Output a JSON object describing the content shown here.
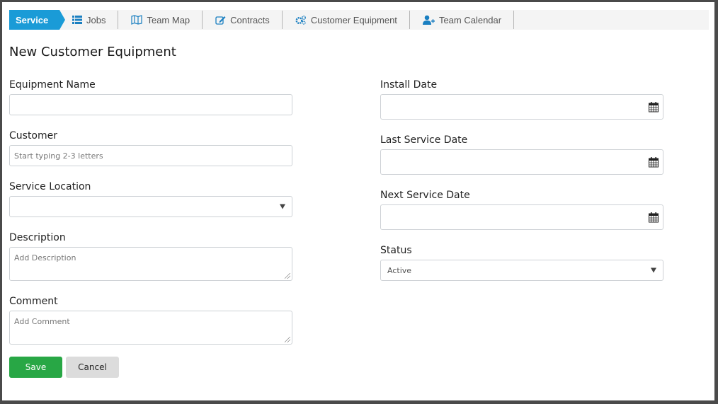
{
  "nav": {
    "section": "Service",
    "items": [
      {
        "label": "Jobs",
        "icon": "list-icon"
      },
      {
        "label": "Team Map",
        "icon": "map-icon"
      },
      {
        "label": "Contracts",
        "icon": "edit-icon"
      },
      {
        "label": "Customer Equipment",
        "icon": "gears-icon"
      },
      {
        "label": "Team Calendar",
        "icon": "user-plus-icon"
      }
    ]
  },
  "page": {
    "title": "New Customer Equipment"
  },
  "form": {
    "equipment_name": {
      "label": "Equipment Name",
      "value": ""
    },
    "customer": {
      "label": "Customer",
      "placeholder": "Start typing 2-3 letters"
    },
    "service_location": {
      "label": "Service Location",
      "value": ""
    },
    "description": {
      "label": "Description",
      "placeholder": "Add Description"
    },
    "comment": {
      "label": "Comment",
      "placeholder": "Add Comment"
    },
    "install_date": {
      "label": "Install Date",
      "value": ""
    },
    "last_service_date": {
      "label": "Last Service Date",
      "value": ""
    },
    "next_service_date": {
      "label": "Next Service Date",
      "value": ""
    },
    "status": {
      "label": "Status",
      "value": "Active"
    }
  },
  "buttons": {
    "save": "Save",
    "cancel": "Cancel"
  },
  "colors": {
    "accent": "#1a9bd7",
    "save": "#28a745",
    "cancel": "#dcdcdc"
  }
}
